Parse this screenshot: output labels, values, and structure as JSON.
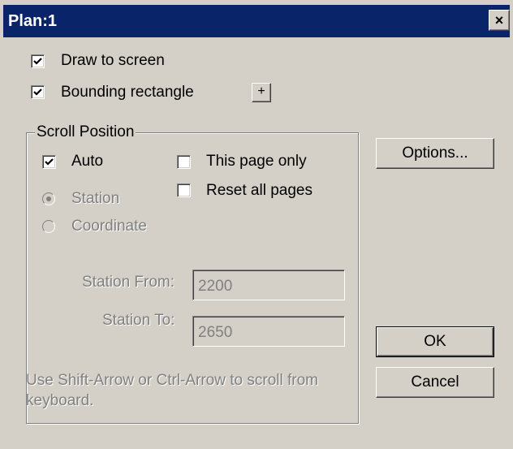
{
  "title": "Plan:1",
  "close_glyph": "×",
  "draw_to_screen": {
    "label": "Draw to screen",
    "checked": true
  },
  "bounding_rectangle": {
    "label": "Bounding rectangle",
    "checked": true
  },
  "plus_label": "+",
  "scroll_position": {
    "legend": "Scroll Position",
    "auto": {
      "label": "Auto",
      "checked": true
    },
    "this_page_only": {
      "label": "This page only",
      "checked": false
    },
    "reset_all_pages": {
      "label": "Reset all pages",
      "checked": false
    },
    "station_radio": {
      "label": "Station",
      "selected": true
    },
    "coordinate_radio": {
      "label": "Coordinate",
      "selected": false
    },
    "station_from": {
      "label": "Station From:",
      "value": "2200"
    },
    "station_to": {
      "label": "Station To:",
      "value": "2650"
    },
    "hint": "Use Shift-Arrow or Ctrl-Arrow to scroll from keyboard."
  },
  "buttons": {
    "options": "Options...",
    "ok": "OK",
    "cancel": "Cancel"
  }
}
